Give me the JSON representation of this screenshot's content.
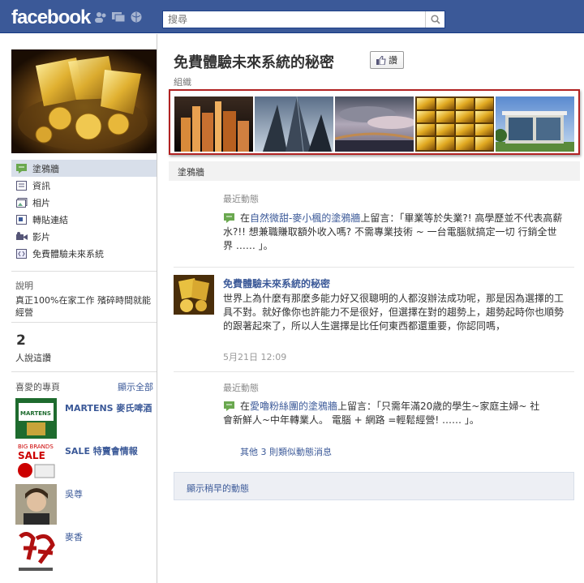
{
  "topbar": {
    "logo": "facebook",
    "search_placeholder": "搜尋"
  },
  "sidebar": {
    "nav": [
      {
        "label": "塗鴉牆",
        "icon": "wall-icon",
        "active": true
      },
      {
        "label": "資訊",
        "icon": "info-icon",
        "active": false
      },
      {
        "label": "相片",
        "icon": "photos-icon",
        "active": false
      },
      {
        "label": "轉貼連結",
        "icon": "links-icon",
        "active": false
      },
      {
        "label": "影片",
        "icon": "video-icon",
        "active": false
      },
      {
        "label": "免費體驗未來系統",
        "icon": "app-icon",
        "active": false
      }
    ],
    "description_title": "說明",
    "description": "真正100%在家工作 殯碎時間就能經營",
    "likes_count": "2",
    "likes_label": "人說這讚",
    "favorites_title": "喜愛的專頁",
    "favorites_see_all": "顯示全部",
    "favorites": [
      {
        "name": "MARTENS 麥氏啤酒"
      },
      {
        "name": "SALE 特賣會情報"
      },
      {
        "name": "吳尊"
      },
      {
        "name": "麥香"
      }
    ]
  },
  "page": {
    "title": "免費體驗未來系統的秘密",
    "like_label": "讚",
    "category": "組織",
    "tab_label": "塗鴉牆"
  },
  "feed": {
    "story1": {
      "type": "最近動態",
      "prefix": "在",
      "link1": "自然微甜-麥小楓的塗鴉牆",
      "text": "上留言：「畢業等於失業?! 高學歷並不代表高薪水?!! 想兼職賺取額外收入嗎? 不需專業技術 ~ 一台電腦就搞定一切 行銷全世界 …… 」。"
    },
    "story2": {
      "author": "免費體驗未來系統的秘密",
      "text": "世界上為什麼有那麼多能力好又很聰明的人都沒辦法成功呢，那是因為選擇的工具不對。就好像你也許能力不是很好，但選擇在對的趨勢上，趨勢起時你也順勢的跟著起來了，所以人生選擇是比任何東西都還重要，你認同嗎，",
      "timestamp": "5月21日 12:09"
    },
    "story3": {
      "type": "最近動態",
      "prefix": "在",
      "link1": "愛嚕粉絲團的塗鴉牆",
      "text": "上留言：「只需年滿20歲的學生~家庭主婦~ 社會新鮮人~中年轉業人。 電腦 + 網路 =輕鬆經營! …… 」。",
      "more": "其他 3 則類似動態消息"
    },
    "older_label": "顯示稍早的動態"
  },
  "colors": {
    "brand": "#3b5998",
    "strip_border": "#b22222",
    "nav_active": "#d8dfea"
  }
}
